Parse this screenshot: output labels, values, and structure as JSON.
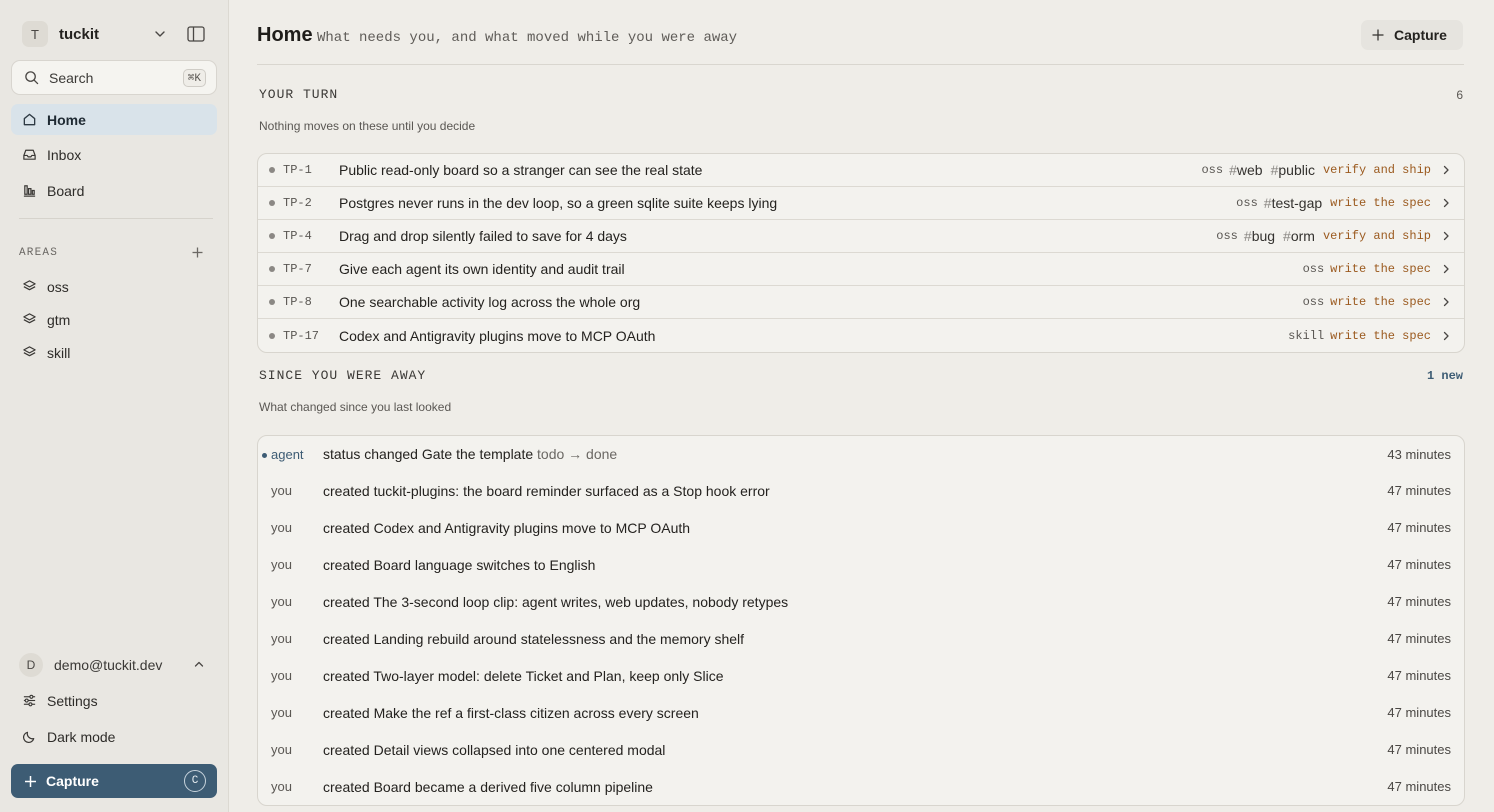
{
  "sidebar": {
    "workspace": {
      "initial": "T",
      "name": "tuckit"
    },
    "search": {
      "label": "Search",
      "shortcut": "⌘K"
    },
    "nav": [
      {
        "label": "Home",
        "icon": "home-icon",
        "active": true
      },
      {
        "label": "Inbox",
        "icon": "inbox-icon"
      },
      {
        "label": "Board",
        "icon": "board-icon"
      }
    ],
    "areas_label": "AREAS",
    "areas": [
      {
        "label": "oss",
        "icon": "layers-icon"
      },
      {
        "label": "gtm",
        "icon": "layers-icon"
      },
      {
        "label": "skill",
        "icon": "layers-icon"
      }
    ],
    "user": {
      "initial": "D",
      "email": "demo@tuckit.dev"
    },
    "settings_label": "Settings",
    "dark_mode_label": "Dark mode",
    "capture": {
      "label": "Capture",
      "shortcut": "C"
    }
  },
  "main": {
    "title": "Home",
    "subtitle": "What needs you, and what moved while you were away",
    "capture_label": "Capture",
    "your_turn": {
      "title": "YOUR TURN",
      "count": "6",
      "subtitle": "Nothing moves on these until you decide",
      "rows": [
        {
          "ref": "TP-1",
          "title": "Public read-only board so a stranger can see the real state",
          "area": "oss",
          "tags": [
            "web",
            "public"
          ],
          "next": "verify and ship"
        },
        {
          "ref": "TP-2",
          "title": "Postgres never runs in the dev loop, so a green sqlite suite keeps lying",
          "area": "oss",
          "tags": [
            "test-gap"
          ],
          "next": "write the spec"
        },
        {
          "ref": "TP-4",
          "title": "Drag and drop silently failed to save for 4 days",
          "area": "oss",
          "tags": [
            "bug",
            "orm"
          ],
          "next": "verify and ship"
        },
        {
          "ref": "TP-7",
          "title": "Give each agent its own identity and audit trail",
          "area": "oss",
          "tags": [],
          "next": "write the spec"
        },
        {
          "ref": "TP-8",
          "title": "One searchable activity log across the whole org",
          "area": "oss",
          "tags": [],
          "next": "write the spec"
        },
        {
          "ref": "TP-17",
          "title": "Codex and Antigravity plugins move to MCP OAuth",
          "area": "skill",
          "tags": [],
          "next": "write the spec"
        }
      ]
    },
    "since_away": {
      "title": "SINCE YOU WERE AWAY",
      "count": "1 new",
      "subtitle": "What changed since you last looked",
      "rows": [
        {
          "actor": "agent",
          "unread": true,
          "text": "status changed Gate the template",
          "transition": "todo → done",
          "time": "43 minutes"
        },
        {
          "actor": "you",
          "text": "created tuckit-plugins: the board reminder surfaced as a Stop hook error",
          "time": "47 minutes"
        },
        {
          "actor": "you",
          "text": "created Codex and Antigravity plugins move to MCP OAuth",
          "time": "47 minutes"
        },
        {
          "actor": "you",
          "text": "created Board language switches to English",
          "time": "47 minutes"
        },
        {
          "actor": "you",
          "text": "created The 3-second loop clip: agent writes, web updates, nobody retypes",
          "time": "47 minutes"
        },
        {
          "actor": "you",
          "text": "created Landing rebuild around statelessness and the memory shelf",
          "time": "47 minutes"
        },
        {
          "actor": "you",
          "text": "created Two-layer model: delete Ticket and Plan, keep only Slice",
          "time": "47 minutes"
        },
        {
          "actor": "you",
          "text": "created Make the ref a first-class citizen across every screen",
          "time": "47 minutes"
        },
        {
          "actor": "you",
          "text": "created Detail views collapsed into one centered modal",
          "time": "47 minutes"
        },
        {
          "actor": "you",
          "text": "created Board became a derived five column pipeline",
          "time": "47 minutes"
        }
      ]
    }
  },
  "colors": {
    "accent": "#3d5c74",
    "next_step": "#9b5a1f",
    "active_nav": "#d9e3ea"
  }
}
